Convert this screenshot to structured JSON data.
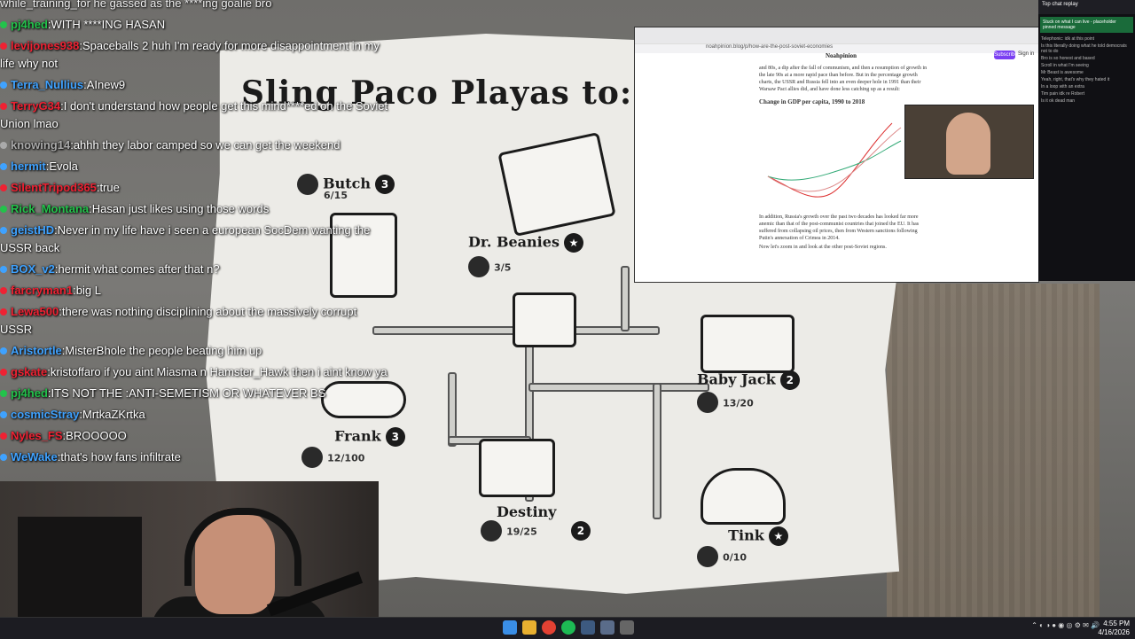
{
  "chat": [
    {
      "user": "pj4hed",
      "dot": "#23c24b",
      "text": "WITH ****ING HASAN"
    },
    {
      "user": "levijones938",
      "dot": "#e23",
      "text": "Spaceballs 2 huh I'm ready for more disappointment in my life why not"
    },
    {
      "user": "Terra_Nullius",
      "dot": "#3fa2ff",
      "text": "AInew9"
    },
    {
      "user": "TerryG34",
      "dot": "#e23",
      "text": "I don't understand how people get this mind****ed on the Soviet Union lmao"
    },
    {
      "user": "knowing14",
      "dot": "#aaa",
      "text": "ahhh they labor camped so we can get the weekend"
    },
    {
      "user": "hermit",
      "dot": "#3fa2ff",
      "text": "Evola"
    },
    {
      "user": "SilentTripod365",
      "dot": "#e23",
      "text": "true"
    },
    {
      "user": "Rick_Montana",
      "dot": "#23c24b",
      "text": "Hasan just likes using those words"
    },
    {
      "user": "geistHD",
      "dot": "#3fa2ff",
      "text": "Never in my life have i seen a european SocDem wanting the USSR back"
    },
    {
      "user": "BOX_v2",
      "dot": "#3fa2ff",
      "text": "hermit  what comes after that n?"
    },
    {
      "user": "farcryman1",
      "dot": "#e23",
      "text": "big L"
    },
    {
      "user": "Lewa500",
      "dot": "#e23",
      "text": "there was nothing disciplining about the massively corrupt USSR"
    },
    {
      "user": "Aristortle",
      "dot": "#3fa2ff",
      "text": "MisterBhole the people beating him up"
    },
    {
      "user": "gskate",
      "dot": "#e23",
      "text": "kristoffaro if you aint Miasma n Hamster_Hawk then i aint know ya"
    },
    {
      "user": "pj4hed",
      "dot": "#23c24b",
      "text": "ITS NOT THE :ANTI-SEMETISM OR WHATEVER BS"
    },
    {
      "user": "cosmicStray",
      "dot": "#3fa2ff",
      "text": "MrtkaZKrtka"
    },
    {
      "user": "Nyles_FS",
      "dot": "#e23",
      "text": "BROOOOO"
    },
    {
      "user": "WeWake",
      "dot": "#3fa2ff",
      "text": "that's how  fans infiltrate"
    }
  ],
  "chat_top_partial": "while_training_for he gassed as the ****ing goalie bro",
  "map": {
    "title": "Sling Paco Playas to:",
    "nodes": [
      {
        "name": "Butch",
        "badge": "3",
        "count": "6/15"
      },
      {
        "name": "Dr. Beanies",
        "badge": "★",
        "count": "3/5"
      },
      {
        "name": "Baby Jack",
        "badge": "2",
        "count": "13/20"
      },
      {
        "name": "Frank",
        "badge": "3",
        "count": "12/100"
      },
      {
        "name": "Destiny",
        "badge": "2",
        "count": "19/25"
      },
      {
        "name": "Tink",
        "badge": "★",
        "count": "0/10"
      }
    ]
  },
  "browser": {
    "publication": "Noahpinion",
    "subscribe": "Subscribe",
    "signin": "Sign in",
    "address": "noahpinion.blog/p/how-are-the-post-soviet-economies",
    "para1": "and 80s, a dip after the fall of communism, and then a resumption of growth in the late 90s at a more rapid pace than before. But in the percentage growth charts, the USSR and Russia fell into an even deeper hole in 1991 than their Warsaw Pact allies did, and have done less catching up as a result:",
    "chart_title": "Change in GDP per capita, 1990 to 2018",
    "para2": "In addition, Russia's growth over the past two decades has looked far more anemic than that of the post-communist countries that joined the EU. It has suffered from collapsing oil prices, then from Western sanctions following Putin's annexation of Crimea in 2014.",
    "para3": "Now let's zoom in and look at the other post-Soviet regions."
  },
  "replay": {
    "header": "Top chat replay",
    "highlight": "Stuck on what I can live - placeholder pinned message",
    "rows": [
      "Telephonic: idk at this point",
      "Is this literally doing what he told democrats not to do",
      "Bro is so honest and based",
      "Scroll in what I'm seeing",
      "Mr Beast is awesome",
      "Yeah, right, that's why they hated it",
      "In a loop with an extra",
      "Tim pain idk re Robert",
      "Is it ok dead man"
    ]
  },
  "taskbar": {
    "time": "4:55 PM",
    "date": "4/16/2026"
  },
  "colors": {
    "paper": "#ecebe7",
    "ink": "#1b1b1b",
    "subscribe": "#7a3ff2"
  }
}
